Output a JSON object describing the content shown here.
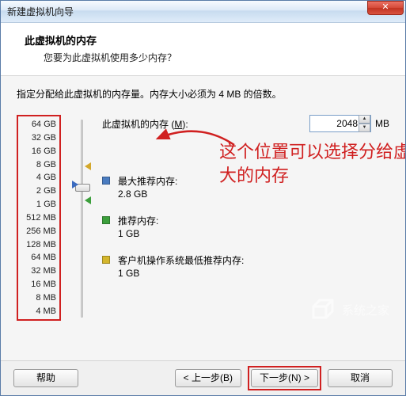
{
  "window": {
    "title": "新建虚拟机向导",
    "close_glyph": "✕"
  },
  "header": {
    "title": "此虚拟机的内存",
    "subtitle": "您要为此虚拟机使用多少内存？"
  },
  "body": {
    "instruction": "指定分配给此虚拟机的内存量。内存大小必须为 4 MB 的倍数。",
    "mem_label_prefix": "此虚拟机的内存 (",
    "mem_label_hotkey": "M",
    "mem_label_suffix": "):",
    "mem_value": "2048",
    "mem_unit": "MB",
    "scale": [
      "64 GB",
      "32 GB",
      "16 GB",
      "8 GB",
      "4 GB",
      "2 GB",
      "1 GB",
      "512 MB",
      "256 MB",
      "128 MB",
      "64 MB",
      "32 MB",
      "16 MB",
      "8 MB",
      "4 MB"
    ],
    "annotation": "这个位置可以选择分给虚拟机多大的内存",
    "recommendations": [
      {
        "color": "blue",
        "label": "最大推荐内存:",
        "value": "2.8 GB"
      },
      {
        "color": "green",
        "label": "推荐内存:",
        "value": "1 GB"
      },
      {
        "color": "yellow",
        "label": "客户机操作系统最低推荐内存:",
        "value": "1 GB"
      }
    ]
  },
  "footer": {
    "help": "帮助",
    "back": "< 上一步(B)",
    "next": "下一步(N) >",
    "cancel": "取消"
  },
  "colors": {
    "highlight": "#d02020"
  }
}
